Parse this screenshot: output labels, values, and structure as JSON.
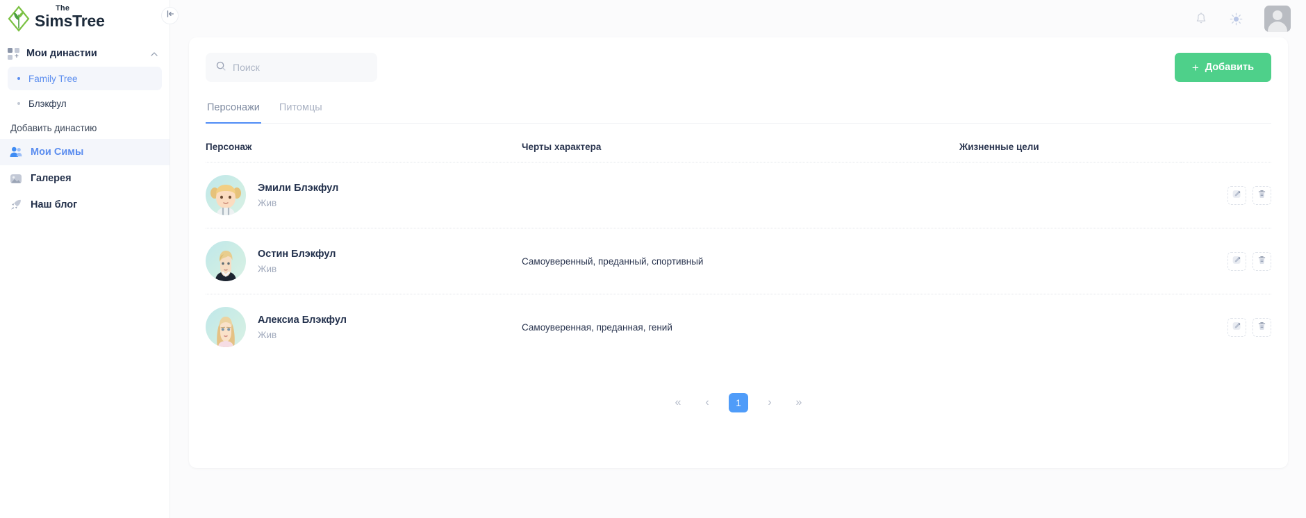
{
  "brand": {
    "the": "The",
    "name": "SimsTree",
    "logo_color": "#5cb85c"
  },
  "sidebar": {
    "group": {
      "label": "Мои династии",
      "icon": "grid-plus-icon",
      "chevron": "chevron-up-icon",
      "items": [
        {
          "label": "Family Tree",
          "active": true
        },
        {
          "label": "Блэкфул",
          "active": false
        }
      ],
      "add_label": "Добавить династию"
    },
    "items": [
      {
        "label": "Мои Симы",
        "icon": "users-icon",
        "active": true
      },
      {
        "label": "Галерея",
        "icon": "image-icon",
        "active": false
      },
      {
        "label": "Наш блог",
        "icon": "rocket-icon",
        "active": false
      }
    ],
    "collapse_icon": "collapse-left-icon"
  },
  "topbar": {
    "notifications_icon": "bell-icon",
    "theme_icon": "sun-icon",
    "avatar": "user-avatar"
  },
  "search": {
    "placeholder": "Поиск",
    "value": "",
    "icon": "search-icon"
  },
  "add_button": {
    "label": "Добавить",
    "plus": "+",
    "color": "#4ed08a"
  },
  "tabs": [
    {
      "label": "Персонажи",
      "active": true
    },
    {
      "label": "Питомцы",
      "active": false
    }
  ],
  "table": {
    "headers": {
      "character": "Персонаж",
      "traits": "Черты характера",
      "goals": "Жизненные цели",
      "actions": ""
    },
    "rows": [
      {
        "name": "Эмили Блэкфул",
        "status": "Жив",
        "traits": "",
        "goals": "",
        "avatar": "child-girl-blonde-pigtails",
        "edit_icon": "pencil-icon",
        "delete_icon": "trash-icon"
      },
      {
        "name": "Остин Блэкфул",
        "status": "Жив",
        "traits": "Самоуверенный, преданный, спортивный",
        "goals": "",
        "avatar": "young-man-blonde",
        "edit_icon": "pencil-icon",
        "delete_icon": "trash-icon"
      },
      {
        "name": "Алексиа Блэкфул",
        "status": "Жив",
        "traits": "Самоуверенная, преданная, гений",
        "goals": "",
        "avatar": "young-woman-blonde",
        "edit_icon": "pencil-icon",
        "delete_icon": "trash-icon"
      }
    ]
  },
  "pagination": {
    "first": "«",
    "prev": "‹",
    "pages": [
      "1"
    ],
    "current": "1",
    "next": "›",
    "last": "»",
    "active_color": "#4f9cf9"
  }
}
